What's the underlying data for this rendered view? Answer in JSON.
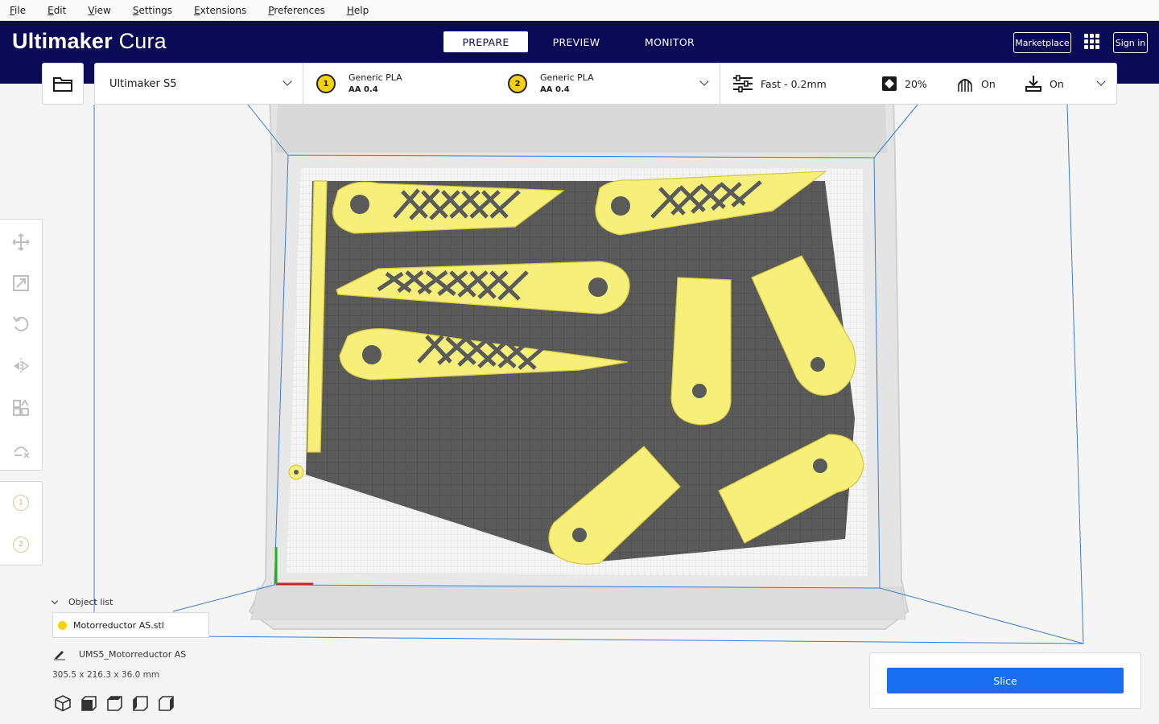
{
  "menu": [
    "File",
    "Edit",
    "View",
    "Settings",
    "Extensions",
    "Preferences",
    "Help"
  ],
  "brand": {
    "bold": "Ultimaker",
    "light": "Cura"
  },
  "stages": {
    "prepare": "PREPARE",
    "preview": "PREVIEW",
    "monitor": "MONITOR"
  },
  "header": {
    "marketplace": "Marketplace",
    "sign_in": "Sign in"
  },
  "printer": {
    "name": "Ultimaker S5"
  },
  "extruders": [
    {
      "index": "1",
      "material": "Generic PLA",
      "core": "AA 0.4"
    },
    {
      "index": "2",
      "material": "Generic PLA",
      "core": "AA 0.4"
    }
  ],
  "print_settings": {
    "profile": "Fast - 0.2mm",
    "infill": "20%",
    "support": "On",
    "adhesion": "On"
  },
  "tools": [
    "move-icon",
    "scale-icon",
    "rotate-icon",
    "mirror-icon",
    "per-model-settings-icon",
    "support-blocker-icon"
  ],
  "extruder_buttons": [
    "1",
    "2"
  ],
  "object_list": {
    "title": "Object list",
    "items": [
      "Motorreductor AS.stl"
    ]
  },
  "job": {
    "name": "UMS5_Motorreductor AS",
    "dimensions": "305.5 x 216.3 x 36.0 mm"
  },
  "camera_views": [
    "3d-view-icon",
    "front-view-icon",
    "top-view-icon",
    "left-view-icon",
    "right-view-icon"
  ],
  "slice": {
    "label": "Slice"
  },
  "colors": {
    "header": "#0a0a56",
    "accent": "#196ef0",
    "model": "#f6f07a",
    "plate": "#5a5a5a"
  }
}
